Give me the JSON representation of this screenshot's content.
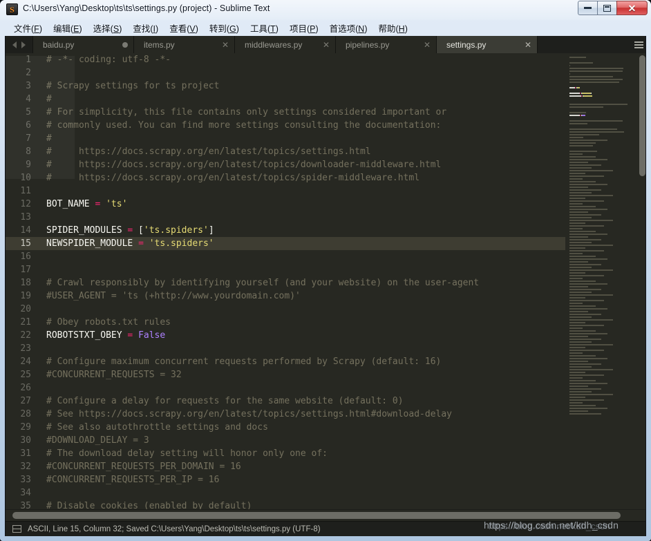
{
  "window": {
    "title": "C:\\Users\\Yang\\Desktop\\ts\\ts\\settings.py (project) - Sublime Text",
    "app_icon_letter": "S",
    "controls": {
      "minimize": "–",
      "maximize": "□",
      "close": "✕"
    }
  },
  "menubar": {
    "items": [
      {
        "label": "文件",
        "mnemonic": "F"
      },
      {
        "label": "编辑",
        "mnemonic": "E"
      },
      {
        "label": "选择",
        "mnemonic": "S"
      },
      {
        "label": "查找",
        "mnemonic": "I"
      },
      {
        "label": "查看",
        "mnemonic": "V"
      },
      {
        "label": "转到",
        "mnemonic": "G"
      },
      {
        "label": "工具",
        "mnemonic": "T"
      },
      {
        "label": "项目",
        "mnemonic": "P"
      },
      {
        "label": "首选项",
        "mnemonic": "N"
      },
      {
        "label": "帮助",
        "mnemonic": "H"
      }
    ]
  },
  "tabs": {
    "nav_prev": "◀",
    "nav_next": "▶",
    "close_glyph": "✕",
    "items": [
      {
        "label": "baidu.py",
        "active": false,
        "dirty": true
      },
      {
        "label": "items.py",
        "active": false,
        "dirty": false
      },
      {
        "label": "middlewares.py",
        "active": false,
        "dirty": false
      },
      {
        "label": "pipelines.py",
        "active": false,
        "dirty": false
      },
      {
        "label": "settings.py",
        "active": true,
        "dirty": false
      }
    ]
  },
  "editor": {
    "current_line": 15,
    "first_line": 1,
    "lines": [
      {
        "n": 1,
        "tokens": [
          {
            "t": "# -*- coding: utf-8 -*-",
            "c": "c-comment"
          }
        ]
      },
      {
        "n": 2,
        "tokens": []
      },
      {
        "n": 3,
        "tokens": [
          {
            "t": "# Scrapy settings for ts project",
            "c": "c-comment"
          }
        ]
      },
      {
        "n": 4,
        "tokens": [
          {
            "t": "#",
            "c": "c-comment"
          }
        ]
      },
      {
        "n": 5,
        "tokens": [
          {
            "t": "# For simplicity, this file contains only settings considered important or",
            "c": "c-comment"
          }
        ]
      },
      {
        "n": 6,
        "tokens": [
          {
            "t": "# commonly used. You can find more settings consulting the documentation:",
            "c": "c-comment"
          }
        ]
      },
      {
        "n": 7,
        "tokens": [
          {
            "t": "#",
            "c": "c-comment"
          }
        ]
      },
      {
        "n": 8,
        "tokens": [
          {
            "t": "#     https://docs.scrapy.org/en/latest/topics/settings.html",
            "c": "c-comment"
          }
        ]
      },
      {
        "n": 9,
        "tokens": [
          {
            "t": "#     https://docs.scrapy.org/en/latest/topics/downloader-middleware.html",
            "c": "c-comment"
          }
        ]
      },
      {
        "n": 10,
        "tokens": [
          {
            "t": "#     https://docs.scrapy.org/en/latest/topics/spider-middleware.html",
            "c": "c-comment"
          }
        ]
      },
      {
        "n": 11,
        "tokens": []
      },
      {
        "n": 12,
        "tokens": [
          {
            "t": "BOT_NAME ",
            "c": "c-punct"
          },
          {
            "t": "=",
            "c": "c-op"
          },
          {
            "t": " ",
            "c": "c-punct"
          },
          {
            "t": "'ts'",
            "c": "c-string"
          }
        ]
      },
      {
        "n": 13,
        "tokens": []
      },
      {
        "n": 14,
        "tokens": [
          {
            "t": "SPIDER_MODULES ",
            "c": "c-punct"
          },
          {
            "t": "=",
            "c": "c-op"
          },
          {
            "t": " [",
            "c": "c-punct"
          },
          {
            "t": "'ts.spiders'",
            "c": "c-string"
          },
          {
            "t": "]",
            "c": "c-punct"
          }
        ]
      },
      {
        "n": 15,
        "tokens": [
          {
            "t": "NEWSPIDER_MODULE ",
            "c": "c-punct"
          },
          {
            "t": "=",
            "c": "c-op"
          },
          {
            "t": " ",
            "c": "c-punct"
          },
          {
            "t": "'ts.spiders'",
            "c": "c-string"
          }
        ]
      },
      {
        "n": 16,
        "tokens": []
      },
      {
        "n": 17,
        "tokens": []
      },
      {
        "n": 18,
        "tokens": [
          {
            "t": "# Crawl responsibly by identifying yourself (and your website) on the user-agent",
            "c": "c-comment"
          }
        ]
      },
      {
        "n": 19,
        "tokens": [
          {
            "t": "#USER_AGENT = 'ts (+http://www.yourdomain.com)'",
            "c": "c-comment"
          }
        ]
      },
      {
        "n": 20,
        "tokens": []
      },
      {
        "n": 21,
        "tokens": [
          {
            "t": "# Obey robots.txt rules",
            "c": "c-comment"
          }
        ]
      },
      {
        "n": 22,
        "tokens": [
          {
            "t": "ROBOTSTXT_OBEY ",
            "c": "c-punct"
          },
          {
            "t": "=",
            "c": "c-op"
          },
          {
            "t": " ",
            "c": "c-punct"
          },
          {
            "t": "False",
            "c": "c-const"
          }
        ]
      },
      {
        "n": 23,
        "tokens": []
      },
      {
        "n": 24,
        "tokens": [
          {
            "t": "# Configure maximum concurrent requests performed by Scrapy (default: 16)",
            "c": "c-comment"
          }
        ]
      },
      {
        "n": 25,
        "tokens": [
          {
            "t": "#CONCURRENT_REQUESTS = 32",
            "c": "c-comment"
          }
        ]
      },
      {
        "n": 26,
        "tokens": []
      },
      {
        "n": 27,
        "tokens": [
          {
            "t": "# Configure a delay for requests for the same website (default: 0)",
            "c": "c-comment"
          }
        ]
      },
      {
        "n": 28,
        "tokens": [
          {
            "t": "# See https://docs.scrapy.org/en/latest/topics/settings.html#download-delay",
            "c": "c-comment"
          }
        ]
      },
      {
        "n": 29,
        "tokens": [
          {
            "t": "# See also autothrottle settings and docs",
            "c": "c-comment"
          }
        ]
      },
      {
        "n": 30,
        "tokens": [
          {
            "t": "#DOWNLOAD_DELAY = 3",
            "c": "c-comment"
          }
        ]
      },
      {
        "n": 31,
        "tokens": [
          {
            "t": "# The download delay setting will honor only one of:",
            "c": "c-comment"
          }
        ]
      },
      {
        "n": 32,
        "tokens": [
          {
            "t": "#CONCURRENT_REQUESTS_PER_DOMAIN = 16",
            "c": "c-comment"
          }
        ]
      },
      {
        "n": 33,
        "tokens": [
          {
            "t": "#CONCURRENT_REQUESTS_PER_IP = 16",
            "c": "c-comment"
          }
        ]
      },
      {
        "n": 34,
        "tokens": []
      },
      {
        "n": 35,
        "tokens": [
          {
            "t": "# Disable cookies (enabled by default)",
            "c": "c-comment"
          }
        ]
      }
    ]
  },
  "statusbar": {
    "text": "ASCII, Line 15, Column 32; Saved C:\\Users\\Yang\\Desktop\\ts\\ts\\settings.py (UTF-8)"
  },
  "watermark": {
    "text": "https://blog.csdn.net/kdh_csdn"
  },
  "colors": {
    "editor_bg": "#272822",
    "current_line_bg": "#3e3d32",
    "chrome_bg": "#1e1f1c",
    "tab_active_bg": "#3b3c35",
    "comment": "#75715e",
    "operator": "#f92672",
    "string": "#e6db74",
    "constant": "#ae81ff",
    "foreground": "#f8f8f2",
    "gutter_fg": "#6a6a62",
    "close_button": "#c83232",
    "app_accent": "#f08a24"
  }
}
